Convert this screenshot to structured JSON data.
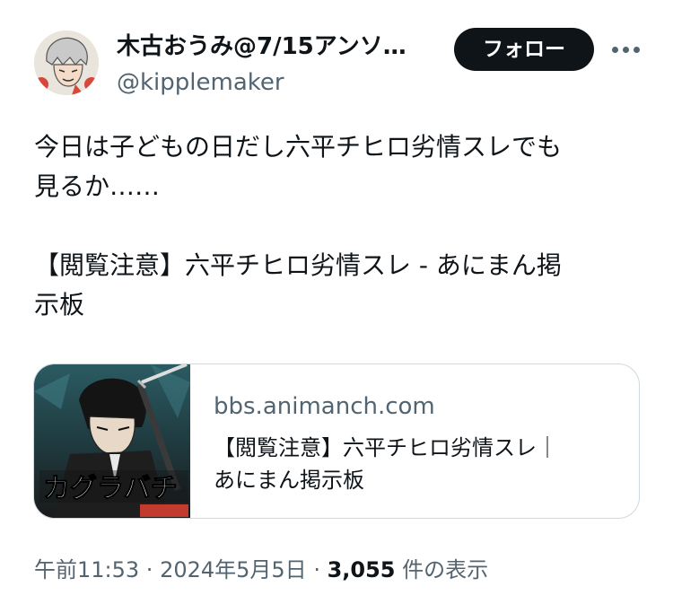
{
  "author": {
    "display_name": "木古おうみ@7/15アンソ…",
    "handle": "@kipplemaker"
  },
  "follow_label": "フォロー",
  "more_icon": "more-horizontal-icon",
  "tweet": {
    "line1": "今日は子どもの日だし六平チヒロ劣情スレでも",
    "line2": "見るか……",
    "line3": "【閲覧注意】六平チヒロ劣情スレ - あにまん掲",
    "line4": "示板"
  },
  "link_card": {
    "domain": "bbs.animanch.com",
    "title_line1": "【閲覧注意】六平チヒロ劣情スレ｜",
    "title_line2": "あにまん掲示板",
    "thumb_text": "カグラバチ"
  },
  "meta": {
    "time": "午前11:53",
    "sep1": " · ",
    "date": "2024年5月5日",
    "sep2": " · ",
    "views_count": "3,055",
    "views_label": " 件の表示"
  },
  "colors": {
    "text": "#0f1419",
    "secondary": "#536471",
    "button_bg": "#0f1419",
    "border": "#cfd9de"
  }
}
